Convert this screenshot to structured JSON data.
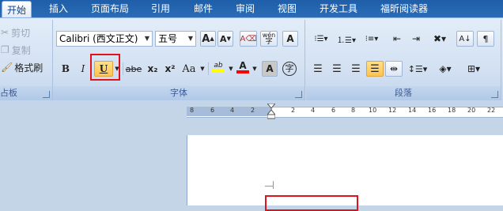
{
  "tabs": [
    "开始",
    "插入",
    "页面布局",
    "引用",
    "邮件",
    "审阅",
    "视图",
    "开发工具",
    "福昕阅读器"
  ],
  "clipboard": {
    "title": "占板",
    "cut": "剪切",
    "copy": "复制",
    "format_painter": "格式刷"
  },
  "font": {
    "title": "字体",
    "font_name": "Calibri (西文正文)",
    "font_size": "五号",
    "grow_label": "A",
    "shrink_label": "A",
    "bold": "B",
    "italic": "I",
    "underline": "U",
    "strike": "abe",
    "subscript": "x₂",
    "superscript": "x²",
    "change_case": "Aa",
    "highlight": "ab",
    "font_color": "A",
    "char_shading": "A",
    "phonetic": "wén",
    "enclose": "字"
  },
  "paragraph": {
    "title": "段落"
  },
  "ruler": {
    "labels": [
      "8",
      "6",
      "4",
      "2",
      "2",
      "4",
      "6",
      "8",
      "10",
      "12",
      "14",
      "16",
      "18",
      "20",
      "22"
    ]
  },
  "colors": {
    "highlight_bar": "#ffff00",
    "font_color_bar": "#ff0000",
    "annotation": "#e0131a"
  }
}
